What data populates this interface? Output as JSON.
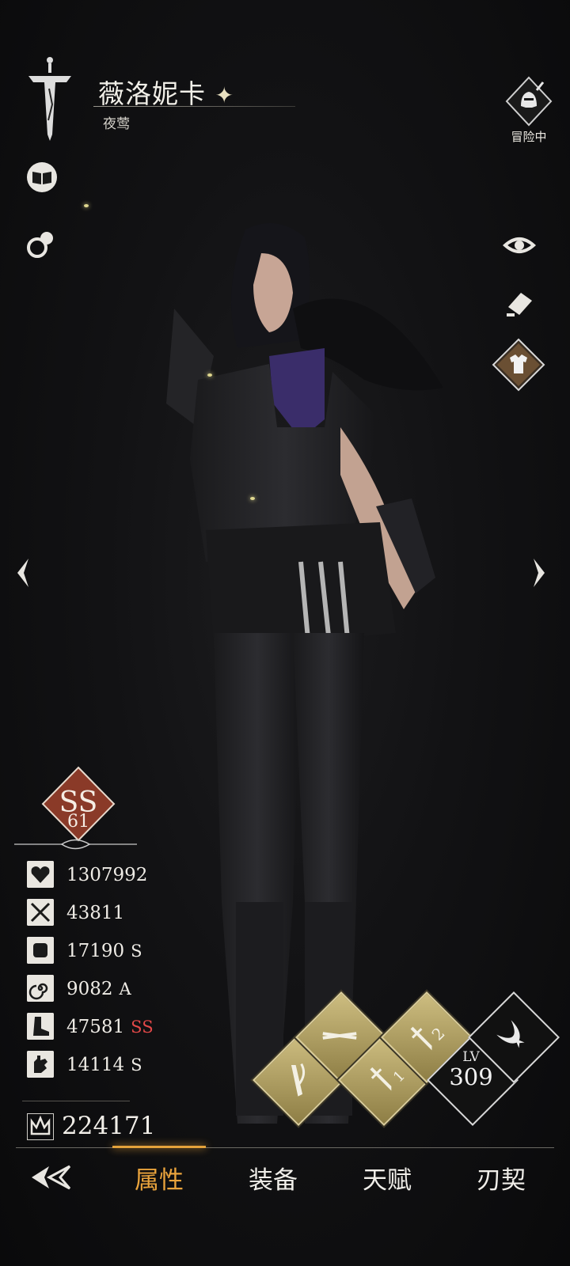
{
  "character": {
    "name": "薇洛妮卡",
    "title": "夜莺"
  },
  "status": {
    "label": "冒险中"
  },
  "rank": {
    "grade": "SS",
    "level": "61"
  },
  "stats": [
    {
      "icon": "heart-icon",
      "value": "1307992",
      "grade": ""
    },
    {
      "icon": "crossed-swords-icon",
      "value": "43811",
      "grade": ""
    },
    {
      "icon": "fist-icon",
      "value": "17190",
      "grade": "S"
    },
    {
      "icon": "spiral-icon",
      "value": "9082",
      "grade": "A"
    },
    {
      "icon": "boot-icon",
      "value": "47581",
      "grade": "SS"
    },
    {
      "icon": "hand-icon",
      "value": "14114",
      "grade": "S"
    }
  ],
  "power": {
    "value": "224171"
  },
  "skills": [
    {
      "icon": "dagger-slash-icon",
      "label": ""
    },
    {
      "icon": "throwing-knives-icon",
      "label": ""
    },
    {
      "icon": "dagger-one-icon",
      "label": "1"
    },
    {
      "icon": "dagger-two-icon",
      "label": "2"
    }
  ],
  "level": {
    "label": "LV",
    "value": "309"
  },
  "tabs": [
    {
      "label": "属性",
      "active": true
    },
    {
      "label": "装备",
      "active": false
    },
    {
      "label": "天赋",
      "active": false
    },
    {
      "label": "刃契",
      "active": false
    }
  ],
  "colors": {
    "accent": "#e9a33c",
    "ss_grade": "#e24848",
    "skill_gold": "#cdbd80",
    "rank_red": "#8a3a28"
  }
}
